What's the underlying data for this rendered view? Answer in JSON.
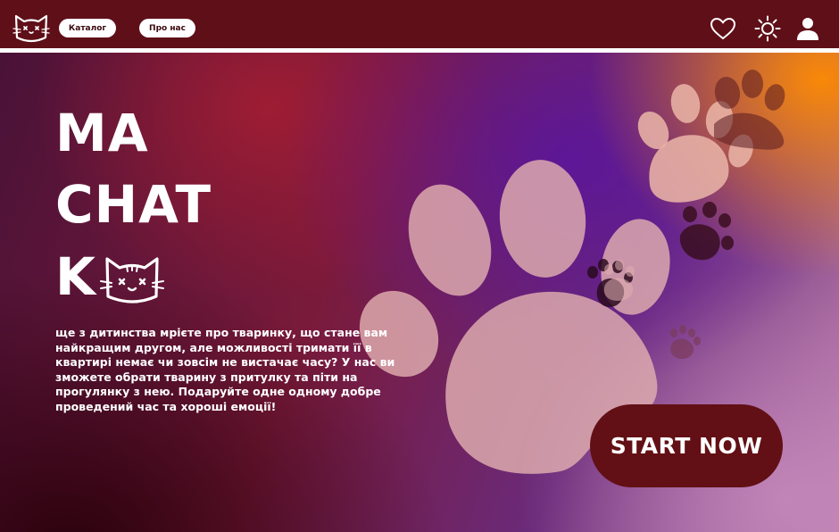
{
  "header": {
    "logo_icon": "cat-face-icon",
    "nav": [
      {
        "label": "Каталог"
      },
      {
        "label": "Про нас"
      }
    ],
    "icons": [
      "heart-icon",
      "sun-icon",
      "user-icon"
    ]
  },
  "hero": {
    "title_lines": [
      "MA",
      "CHAT",
      "K"
    ],
    "title_icon": "cat-face-icon",
    "description": "ще з дитинства мрієте про тваринку, що стане вам найкращим другом, але можливості тримати її в квартирі немає чи зовсім не вистачає часу? У нас ви зможете обрати тварину з притулку та піти на прогулянку з нею. Подаруйте одне одному добре проведений час та хороші емоції!",
    "cta_label": "START NOW"
  },
  "colors": {
    "header_bg": "#5f0f18",
    "cta_bg": "#621015",
    "paw_big": "#e0aeb0",
    "paw_dark": "#3a0e20"
  }
}
